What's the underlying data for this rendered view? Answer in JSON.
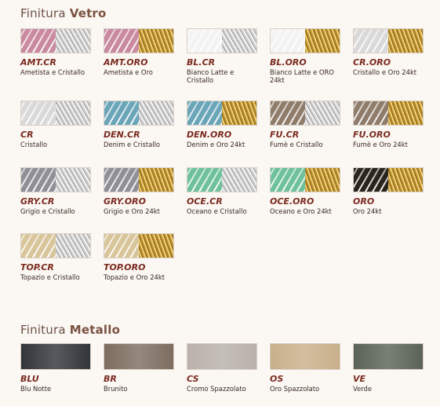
{
  "sections": {
    "vetro": {
      "prefix": "Finitura",
      "strong": "Vetro"
    },
    "metallo": {
      "prefix": "Finitura",
      "strong": "Metallo"
    }
  },
  "vetro_items": [
    {
      "code": "AMT.CR",
      "name": "Ametista e Cristallo",
      "left": "#c98aa0",
      "right": "silver"
    },
    {
      "code": "AMT.ORO",
      "name": "Ametista e Oro",
      "left": "#c98aa0",
      "right": "gold"
    },
    {
      "code": "BL.CR",
      "name": "Bianco Latte e Cristallo",
      "left": "#f3f3f3",
      "right": "silver"
    },
    {
      "code": "BL.ORO",
      "name": "Bianco Latte e ORO 24kt",
      "left": "#f3f3f3",
      "right": "gold"
    },
    {
      "code": "CR.ORO",
      "name": "Cristallo e Oro 24kt",
      "left": "#d9d9d9",
      "right": "gold"
    },
    {
      "code": "CR",
      "name": "Cristallo",
      "left": "#d9d9d9",
      "right": "silver"
    },
    {
      "code": "DEN.CR",
      "name": "Denim e Cristallo",
      "left": "#6aa5b8",
      "right": "silver"
    },
    {
      "code": "DEN.ORO",
      "name": "Denim e Oro 24kt",
      "left": "#6aa5b8",
      "right": "gold"
    },
    {
      "code": "FU.CR",
      "name": "Fumè e Cristallo",
      "left": "#8f7c6b",
      "right": "silver"
    },
    {
      "code": "FU.ORO",
      "name": "Fumè e Oro 24kt",
      "left": "#8f7c6b",
      "right": "gold"
    },
    {
      "code": "GRY.CR",
      "name": "Grigio e Cristallo",
      "left": "#8f8f98",
      "right": "silver"
    },
    {
      "code": "GRY.ORO",
      "name": "Grigio e Oro 24kt",
      "left": "#8f8f98",
      "right": "gold"
    },
    {
      "code": "OCE.CR",
      "name": "Oceano e Cristallo",
      "left": "#6ec19b",
      "right": "silver"
    },
    {
      "code": "OCE.ORO",
      "name": "Oceano e Oro 24kt",
      "left": "#6ec19b",
      "right": "gold"
    },
    {
      "code": "ORO",
      "name": "Oro 24kt",
      "left": "#2a241b",
      "right": "gold"
    },
    {
      "code": "TOP.CR",
      "name": "Topazio e Cristallo",
      "left": "#d8c59a",
      "right": "silver"
    },
    {
      "code": "TOP.ORO",
      "name": "Topazio e Oro 24kt",
      "left": "#d8c59a",
      "right": "gold"
    }
  ],
  "metallo_items": [
    {
      "code": "BLU",
      "name": "Blu Notte",
      "color": "#32363a"
    },
    {
      "code": "BR",
      "name": "Brunito",
      "color": "#7d6d60"
    },
    {
      "code": "CS",
      "name": "Cromo Spazzolato",
      "color": "#b9b1aa"
    },
    {
      "code": "OS",
      "name": "Oro Spazzolato",
      "color": "#c8b08a"
    },
    {
      "code": "VE",
      "name": "Verde",
      "color": "#5b6357"
    }
  ]
}
